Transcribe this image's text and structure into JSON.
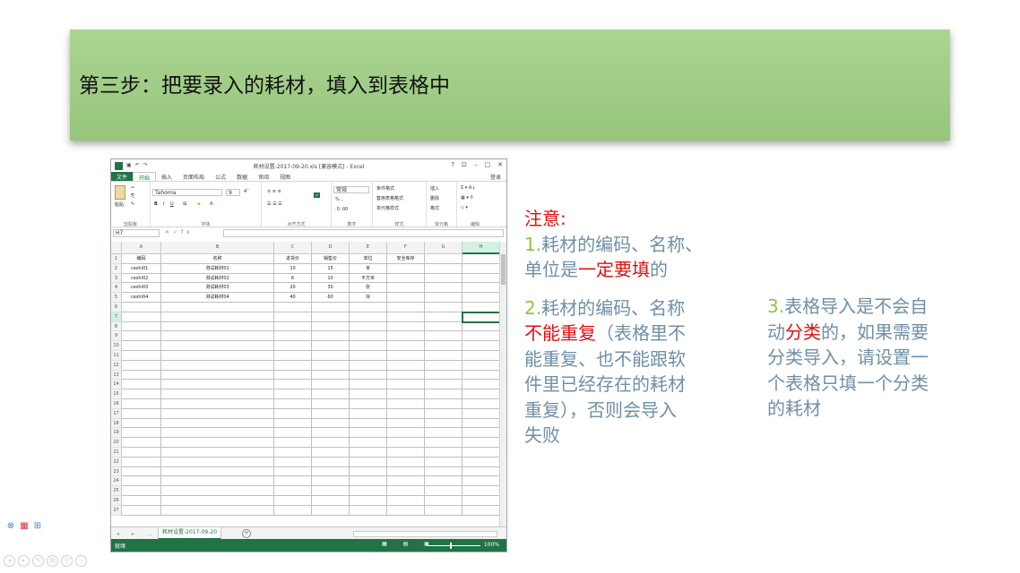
{
  "slide": {
    "title": "第三步：把要录入的耗材，填入到表格中"
  },
  "excel": {
    "window_title": "耗材设置-2017-09-20.xls [兼容模式] - Excel",
    "window_controls": [
      "?",
      "⊡",
      "–",
      "□",
      "✕"
    ],
    "tabs": [
      "文件",
      "开始",
      "插入",
      "页面布局",
      "公式",
      "数据",
      "审阅",
      "视图"
    ],
    "login": "登录",
    "ribbon": {
      "clipboard_label": "剪贴板",
      "paste": "粘贴",
      "font_name": "Tahoma",
      "font_size": "9",
      "font_label": "字体",
      "align_label": "对齐方式",
      "number_format": "常规",
      "number_label": "数字",
      "styles": [
        "条件格式",
        "套用表格格式",
        "单元格样式"
      ],
      "styles_label": "样式",
      "cells": [
        "插入",
        "删除",
        "格式"
      ],
      "cells_label": "单元格",
      "editing_label": "编辑"
    },
    "name_box": "H7",
    "fx": "fx",
    "columns": [
      "A",
      "B",
      "C",
      "D",
      "E",
      "F",
      "G",
      "H"
    ],
    "headers": [
      "编码",
      "名称",
      "进货价",
      "销售价",
      "单位",
      "安全库存"
    ],
    "rows": [
      [
        "ceshi01",
        "测试耗材01",
        "10",
        "15",
        "米",
        ""
      ],
      [
        "ceshi02",
        "测试耗材02",
        "6",
        "10",
        "平方米",
        ""
      ],
      [
        "ceshi03",
        "测试耗材03",
        "20",
        "30",
        "张",
        ""
      ],
      [
        "ceshi04",
        "测试耗材04",
        "40",
        "60",
        "块",
        ""
      ]
    ],
    "row_numbers": [
      "1",
      "2",
      "3",
      "4",
      "5",
      "6",
      "7",
      "8",
      "9",
      "10",
      "11",
      "12",
      "13",
      "14",
      "15",
      "16",
      "17",
      "18",
      "19",
      "20",
      "21",
      "22",
      "23",
      "24",
      "25",
      "26",
      "27"
    ],
    "sheet_tab": "耗材设置-2017-09-20",
    "status_ready": "就绪",
    "zoom": "100%"
  },
  "notes": {
    "heading": "注意:",
    "n1_num": "1.",
    "n1_a": "耗材的编码、名称、",
    "n1_b": "单位是",
    "n1_red": "一定要填",
    "n1_c": "的",
    "n2_num": "2.",
    "n2_a": "耗材的编码、名称",
    "n2_red": "不能重复",
    "n2_b": "（表格里不",
    "n2_c": "能重复、也不能跟软",
    "n2_d": "件里已经存在的耗材",
    "n2_e": "重复），否则会导入",
    "n2_f": "失败",
    "n3_num": "3.",
    "n3_a": "表格导入是不会自",
    "n3_b": "动",
    "n3_red": "分类",
    "n3_c": "的，如果需要",
    "n3_d": "分类导入，请设置一",
    "n3_e": "个表格只填一个分类",
    "n3_f": "的耗材"
  },
  "colors": {
    "banner": "#a5cf8c",
    "excel_green": "#217346",
    "note_text": "#6f8fa8",
    "note_red": "#e01010",
    "note_number": "#8dc63f"
  }
}
